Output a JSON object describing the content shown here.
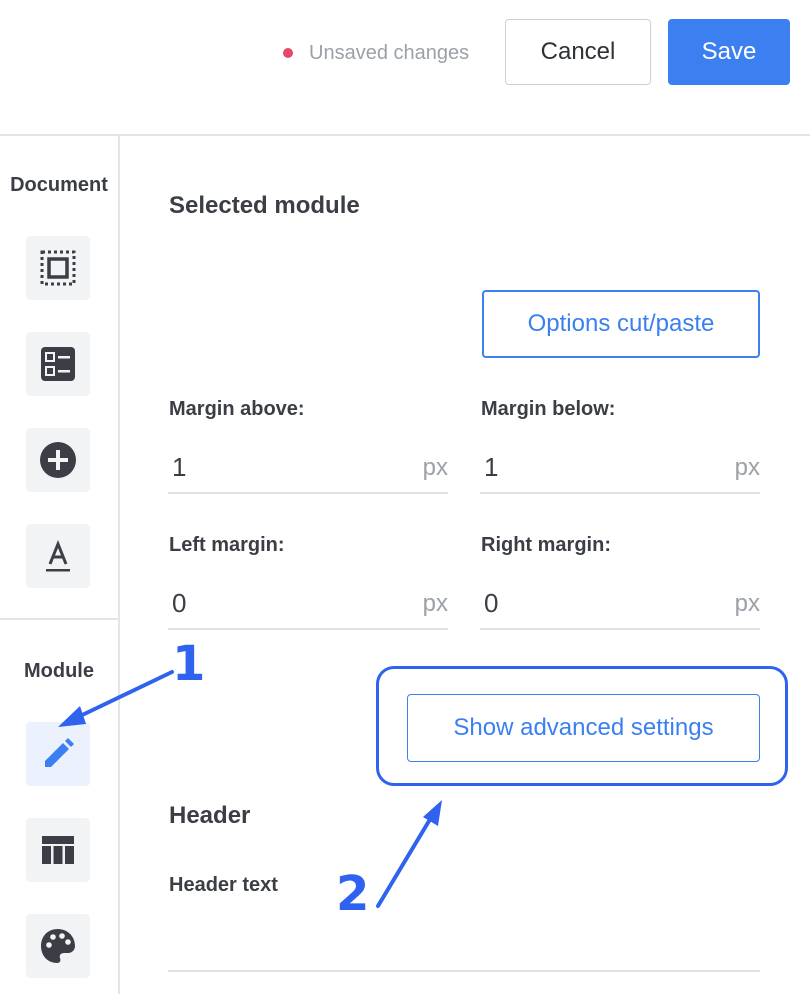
{
  "header": {
    "status_text": "Unsaved changes",
    "cancel_label": "Cancel",
    "save_label": "Save"
  },
  "sidebar": {
    "document_heading": "Document",
    "document_items": [
      "frame-select-icon",
      "list-layout-icon",
      "add-circle-icon",
      "text-format-icon"
    ],
    "module_heading": "Module",
    "module_items": [
      "pencil-icon",
      "table-icon",
      "palette-icon"
    ],
    "active_item": "pencil-icon"
  },
  "main": {
    "selected_module_title": "Selected module",
    "options_cut_paste_label": "Options cut/paste",
    "margin_above": {
      "label": "Margin above:",
      "value": "1",
      "unit": "px"
    },
    "margin_below": {
      "label": "Margin below:",
      "value": "1",
      "unit": "px"
    },
    "left_margin": {
      "label": "Left margin:",
      "value": "0",
      "unit": "px"
    },
    "right_margin": {
      "label": "Right margin:",
      "value": "0",
      "unit": "px"
    },
    "advanced_settings_label": "Show advanced settings",
    "header_title": "Header",
    "header_text_label": "Header text",
    "header_text_value": ""
  },
  "annotations": {
    "step1": "1",
    "step2": "2"
  },
  "colors": {
    "accent": "#3b7ff0",
    "annotation": "#2f62ef",
    "unsaved_dot": "#e5486b"
  }
}
